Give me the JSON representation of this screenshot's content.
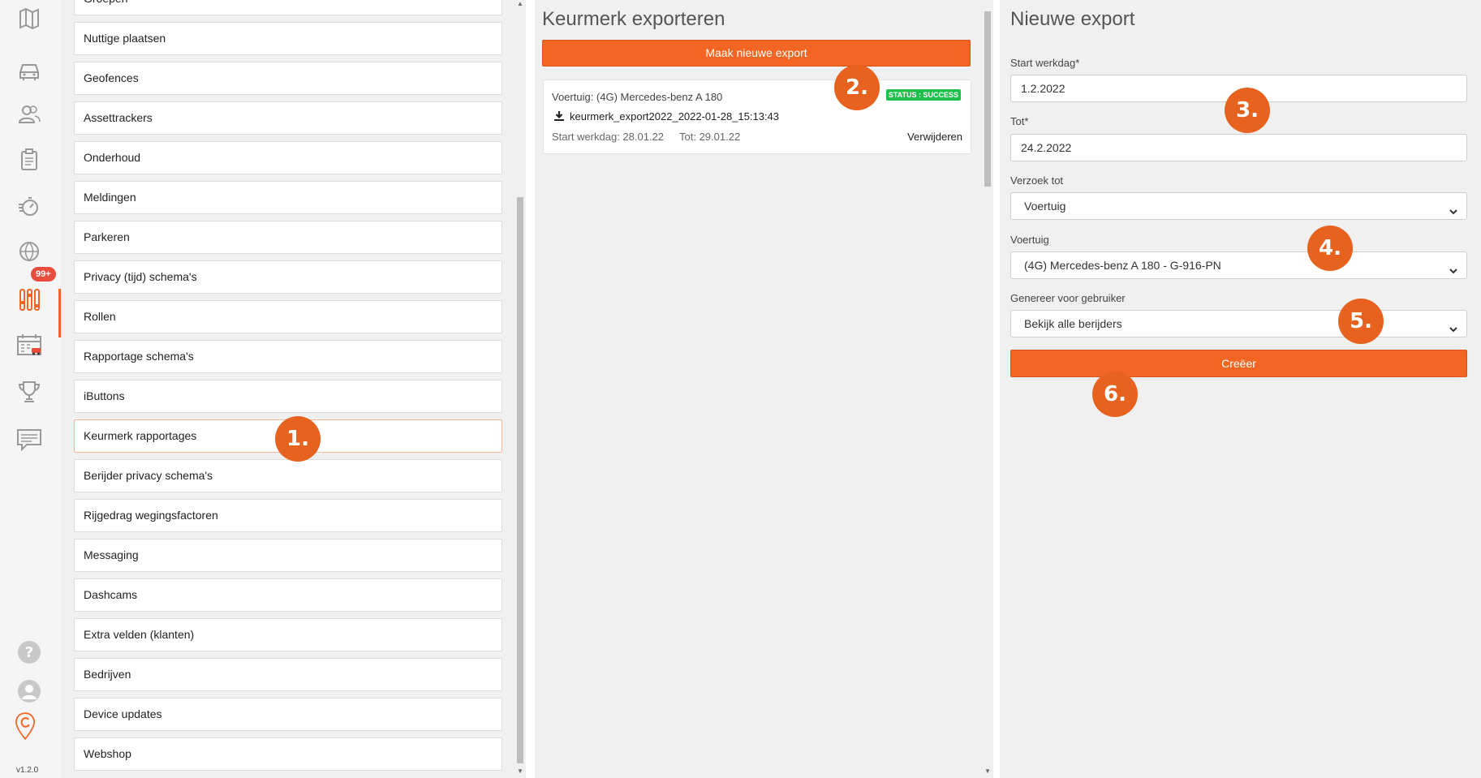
{
  "rail": {
    "badge": "99+",
    "version": "v1.2.0"
  },
  "settings_list": {
    "partial_top": "Groepen",
    "items": [
      "Nuttige plaatsen",
      "Geofences",
      "Assettrackers",
      "Onderhoud",
      "Meldingen",
      "Parkeren",
      "Privacy (tijd) schema's",
      "Rollen",
      "Rapportage schema's",
      "iButtons",
      "Keurmerk rapportages",
      "Berijder privacy schema's",
      "Rijgedrag wegingsfactoren",
      "Messaging",
      "Dashcams",
      "Extra velden (klanten)",
      "Bedrijven",
      "Device updates",
      "Webshop"
    ],
    "active_item": "Keurmerk rapportages"
  },
  "export_panel": {
    "title": "Keurmerk exporteren",
    "new_export_button": "Maak nieuwe export",
    "card": {
      "vehicle": "Voertuig: (4G) Mercedes-benz A 180",
      "status": "STATUS : SUCCESS",
      "file": "keurmerk_export2022_2022-01-28_15:13:43",
      "start": "Start werkdag: 28.01.22",
      "end": "Tot: 29.01.22",
      "delete": "Verwijderen"
    }
  },
  "form": {
    "title": "Nieuwe export",
    "start_label": "Start werkdag*",
    "start_value": "1.2.2022",
    "end_label": "Tot*",
    "end_value": "24.2.2022",
    "request_label": "Verzoek tot",
    "request_value": "Voertuig",
    "vehicle_label": "Voertuig",
    "vehicle_value": "(4G) Mercedes-benz A 180 - G-916-PN",
    "user_label": "Genereer voor gebruiker",
    "user_value": "Bekijk alle berijders",
    "create_button": "Creëer"
  },
  "markers": [
    "1.",
    "2.",
    "3.",
    "4.",
    "5.",
    "6."
  ],
  "colors": {
    "accent": "#f26522",
    "marker": "#e8621f",
    "success": "#1fbf4e",
    "badge": "#e74c3c"
  }
}
